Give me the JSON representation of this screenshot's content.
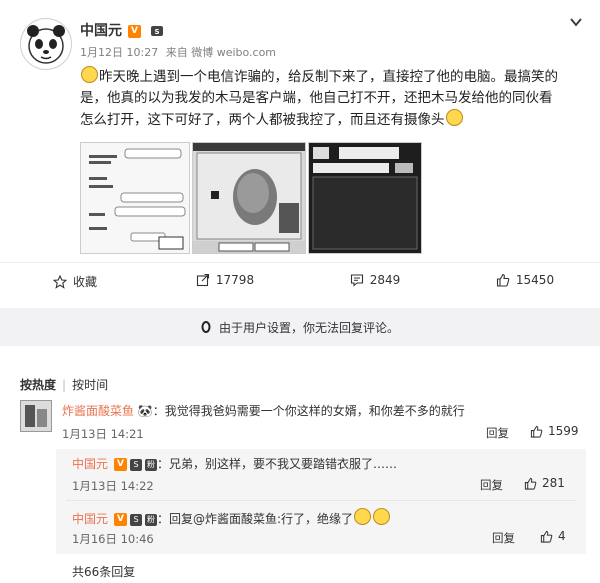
{
  "post": {
    "author": "中国元",
    "verified_badge": "V",
    "time": "1月12日 10:27",
    "source": "来自 微博 weibo.com",
    "text_line1": "昨天晚上遇到一个电信诈骗的，给反制下来了，直接控了他的电脑。最搞笑的",
    "text_line2": "是，他真的以为我发的木马是客户端，他自己打不开，还把木马发给他的同伙看",
    "text_line3": "怎么打开，这下可好了，两个人都被我控了，而且还有摄像头",
    "images": [
      "screenshot-chat-icon",
      "webcam-capture-icon",
      "remote-control-panel-icon"
    ]
  },
  "actions": {
    "favorite_label": "收藏",
    "repost_count": "17798",
    "comment_count": "2849",
    "like_count": "15450"
  },
  "notice": {
    "text": "由于用户设置，你无法回复评论。"
  },
  "sort": {
    "hot": "按热度",
    "time": "按时间"
  },
  "comments": [
    {
      "name": "炸酱面酸菜鱼",
      "text": "：我觉得我爸妈需要一个你这样的女婿，和你差不多的就行",
      "time": "1月13日 14:21",
      "reply_label": "回复",
      "likes": "1599"
    }
  ],
  "replies": [
    {
      "name": "中国元",
      "text": "：兄弟，别这样，要不我又要踏错衣服了……",
      "time": "1月13日 14:22",
      "reply_label": "回复",
      "likes": "281"
    },
    {
      "name": "中国元",
      "text": "：回复@炸酱面酸菜鱼:行了，绝缘了",
      "time": "1月16日 10:46",
      "reply_label": "回复",
      "likes": "4"
    }
  ],
  "total_replies": "共66条回复",
  "colors": {
    "brand_orange": "#ff8200",
    "name_link": "#eb7350",
    "notice_bg": "#f2f2f5"
  }
}
